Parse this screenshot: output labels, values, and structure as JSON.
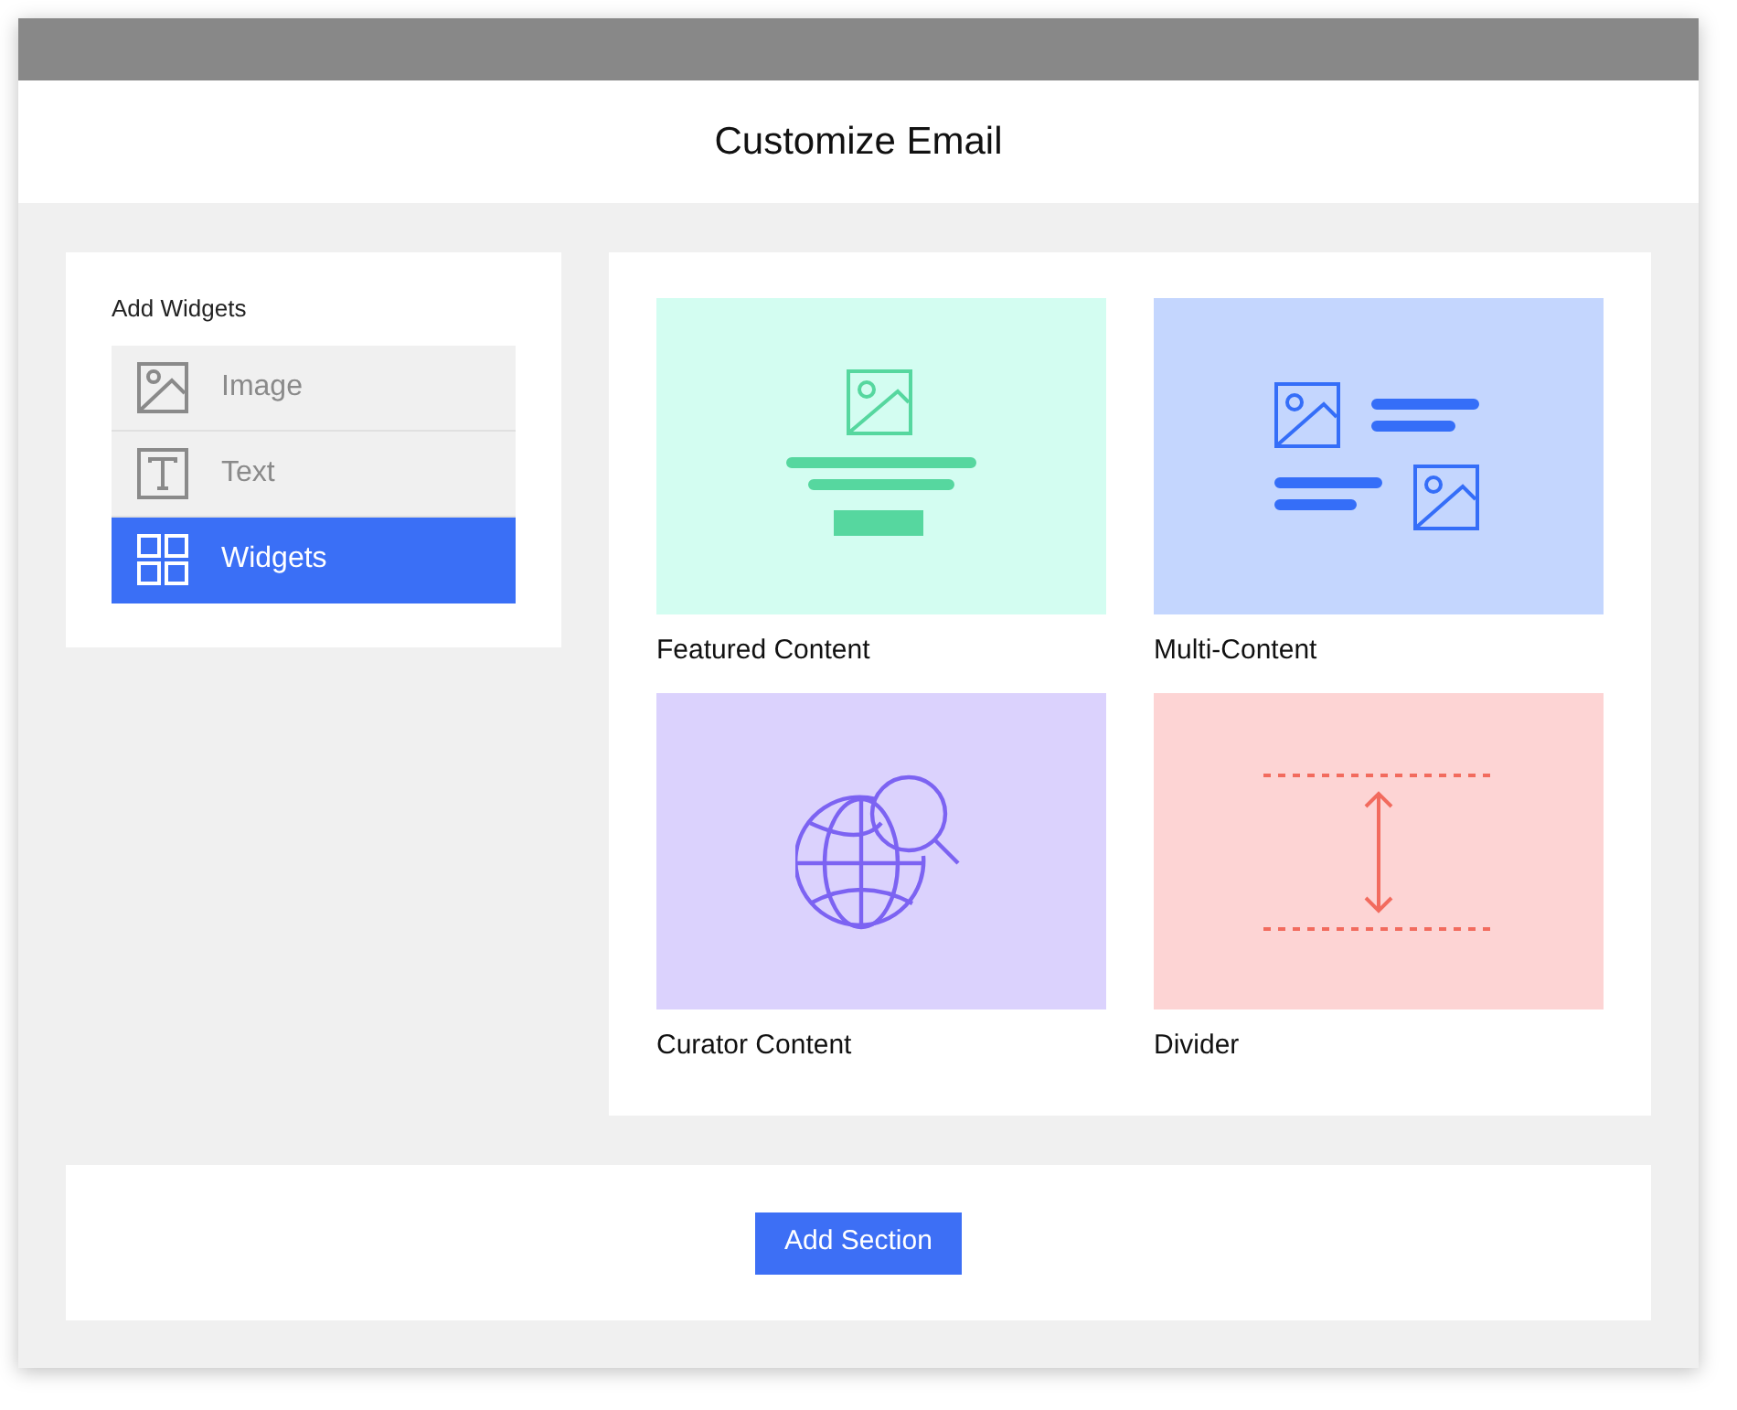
{
  "window": {
    "title": "Customize Email"
  },
  "sidebar": {
    "heading": "Add Widgets",
    "items": [
      {
        "kind": "image",
        "label": "Image",
        "selected": false
      },
      {
        "kind": "text",
        "label": "Text",
        "selected": false
      },
      {
        "kind": "widgets",
        "label": "Widgets",
        "selected": true
      }
    ]
  },
  "widgets": [
    {
      "kind": "featured",
      "label": "Featured Content"
    },
    {
      "kind": "multi",
      "label": "Multi-Content"
    },
    {
      "kind": "curator",
      "label": "Curator Content"
    },
    {
      "kind": "divider",
      "label": "Divider"
    }
  ],
  "footer": {
    "button": "Add Section"
  }
}
